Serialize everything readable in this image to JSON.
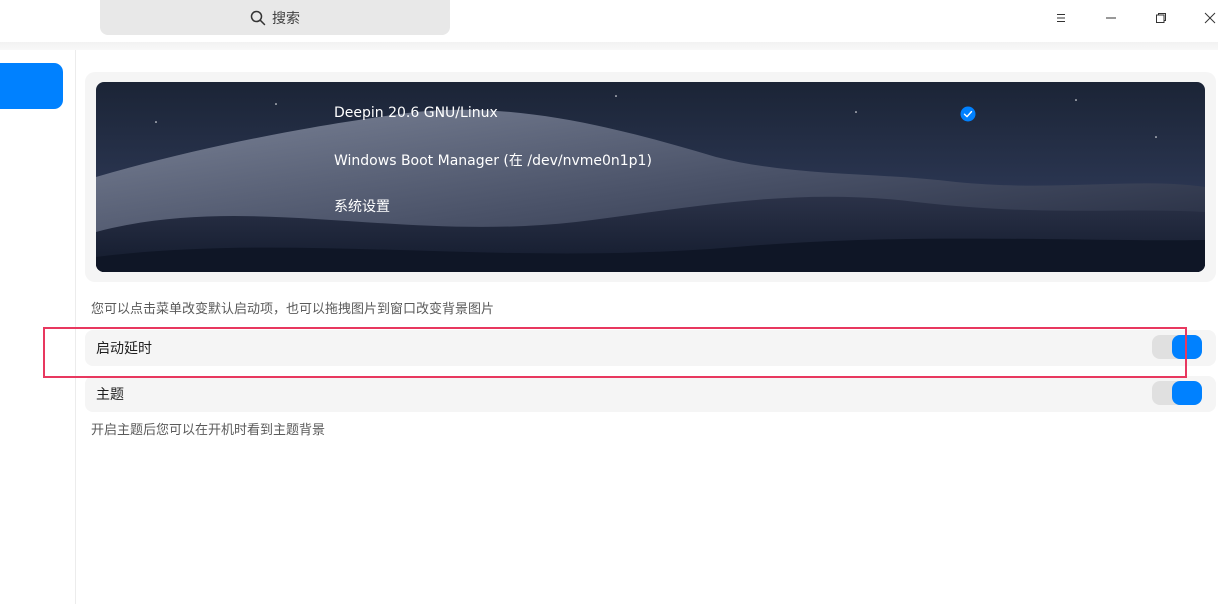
{
  "titlebar": {
    "search_placeholder": "搜索",
    "icons": {
      "search": "search-icon",
      "menu": "menu-icon",
      "minimize": "minimize-icon",
      "maximize": "restore-icon",
      "close": "close-icon"
    }
  },
  "grub": {
    "boot_entries": [
      {
        "label": "Deepin 20.6 GNU/Linux",
        "selected": true
      },
      {
        "label": "Windows Boot Manager (在 /dev/nvme0n1p1)",
        "selected": false
      },
      {
        "label": "系统设置",
        "selected": false
      }
    ],
    "hint": "您可以点击菜单改变默认启动项，也可以拖拽图片到窗口改变背景图片"
  },
  "settings": {
    "boot_delay": {
      "label": "启动延时",
      "enabled": true
    },
    "theme": {
      "label": "主题",
      "enabled": true,
      "hint": "开启主题后您可以在开机时看到主题背景"
    }
  },
  "colors": {
    "accent": "#0081ff",
    "highlight": "#e8385f",
    "card": "#f5f5f5"
  }
}
